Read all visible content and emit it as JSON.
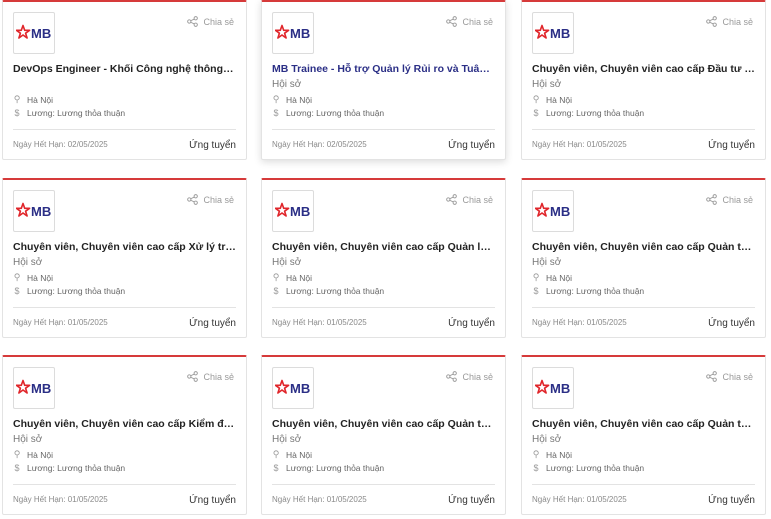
{
  "logo_text": "MB",
  "share_label": "Chia sẻ",
  "apply_label": "Ứng tuyển",
  "colors": {
    "accent": "#d63a3a",
    "brand_purple": "#2b2f86",
    "logo_star": "#e0262b"
  },
  "jobs": [
    {
      "title": "DevOps Engineer - Khối Công nghệ thông tin (H...",
      "department": "",
      "location": "Hà Nội",
      "salary": "Lương: Lương thỏa thuận",
      "deadline": "Ngày Hết Hạn: 02/05/2025"
    },
    {
      "title": "MB Trainee - Hỗ trợ Quản lý Rủi ro và Tuân thủ -...",
      "department": "Hội sở",
      "location": "Hà Nội",
      "salary": "Lương: Lương thỏa thuận",
      "deadline": "Ngày Hết Hạn: 02/05/2025"
    },
    {
      "title": "Chuyên viên, Chuyên viên cao cấp Đầu tư chiến ...",
      "department": "Hội sở",
      "location": "Hà Nội",
      "salary": "Lương: Lương thỏa thuận",
      "deadline": "Ngày Hết Hạn: 01/05/2025"
    },
    {
      "title": "Chuyên viên, Chuyên viên cao cấp Xử lý tranh c...",
      "department": "Hội sở",
      "location": "Hà Nội",
      "salary": "Lương: Lương thỏa thuận",
      "deadline": "Ngày Hết Hạn: 01/05/2025"
    },
    {
      "title": "Chuyên viên, Chuyên viên cao cấp Quản lý giám...",
      "department": "Hội sở",
      "location": "Hà Nội",
      "salary": "Lương: Lương thỏa thuận",
      "deadline": "Ngày Hết Hạn: 01/05/2025"
    },
    {
      "title": "Chuyên viên, Chuyên viên cao cấp Quản trị rủi r...",
      "department": "Hội sở",
      "location": "Hà Nội",
      "salary": "Lương: Lương thỏa thuận",
      "deadline": "Ngày Hết Hạn: 01/05/2025"
    },
    {
      "title": "Chuyên viên, Chuyên viên cao cấp Kiểm định Mô...",
      "department": "Hội sở",
      "location": "Hà Nội",
      "salary": "Lương: Lương thỏa thuận",
      "deadline": "Ngày Hết Hạn: 01/05/2025"
    },
    {
      "title": "Chuyên viên, Chuyên viên cao cấp Quản trị rủi r...",
      "department": "Hội sở",
      "location": "Hà Nội",
      "salary": "Lương: Lương thỏa thuận",
      "deadline": "Ngày Hết Hạn: 01/05/2025"
    },
    {
      "title": "Chuyên viên, Chuyên viên cao cấp Quản trị rủi r...",
      "department": "Hội sở",
      "location": "Hà Nội",
      "salary": "Lương: Lương thỏa thuận",
      "deadline": "Ngày Hết Hạn: 01/05/2025"
    }
  ]
}
